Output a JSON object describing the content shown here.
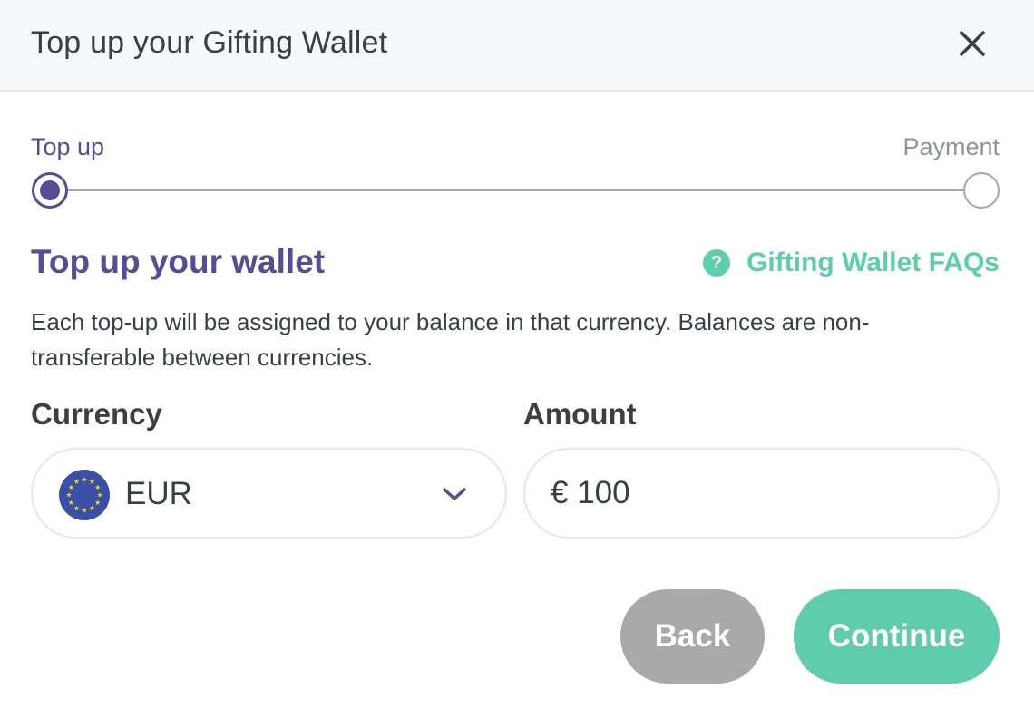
{
  "header": {
    "title": "Top up your Gifting Wallet",
    "close_icon": "close-icon"
  },
  "stepper": {
    "steps": [
      {
        "label": "Top up",
        "state": "active"
      },
      {
        "label": "Payment",
        "state": "inactive"
      }
    ]
  },
  "section": {
    "title": "Top up your wallet",
    "faq_link": "Gifting Wallet FAQs",
    "faq_icon_glyph": "?",
    "description": "Each top-up will be assigned to your balance in that currency. Balances are non-transferable between currencies."
  },
  "form": {
    "currency_label": "Currency",
    "currency_value": "EUR",
    "currency_flag_icon": "eu-flag-icon",
    "amount_label": "Amount",
    "amount_value": "€ 100"
  },
  "actions": {
    "back_label": "Back",
    "continue_label": "Continue"
  },
  "colors": {
    "brand_purple": "#5a4b96",
    "accent_green": "#5ccdad",
    "back_gray": "#a9a9a9",
    "eu_blue": "#3a4fa8",
    "eu_gold": "#ffd600"
  }
}
